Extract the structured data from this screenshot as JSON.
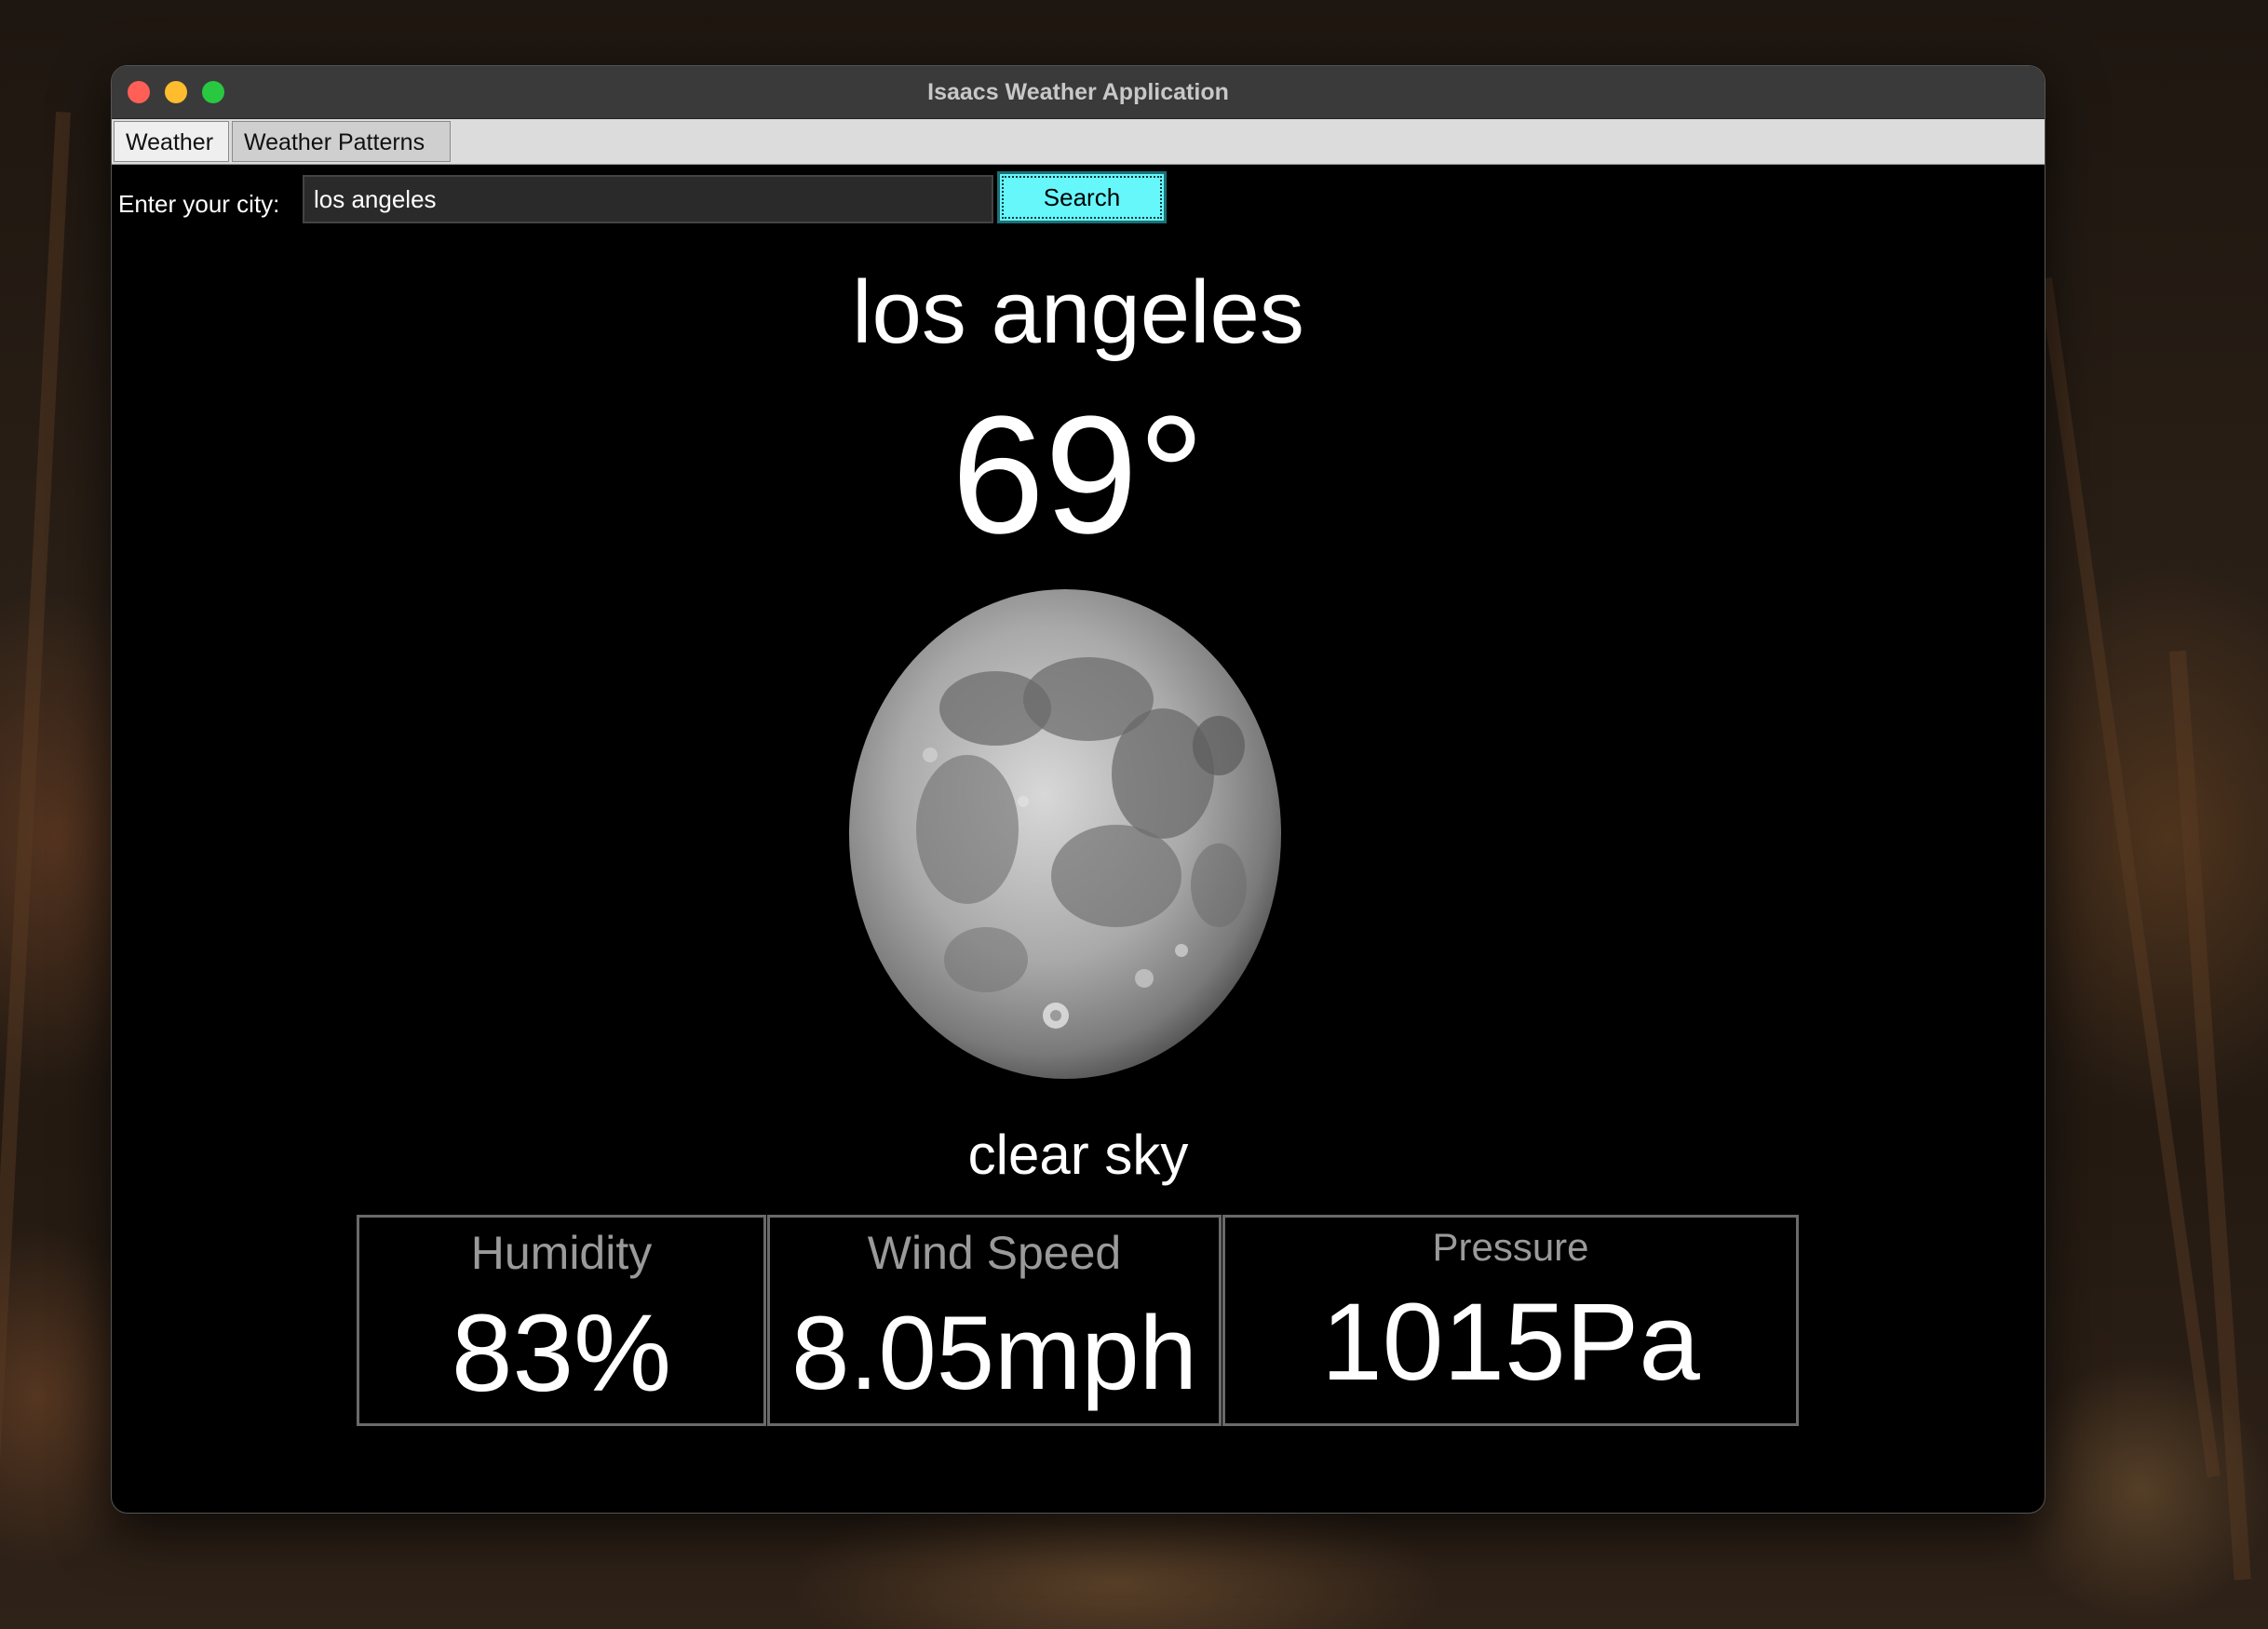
{
  "window": {
    "title": "Isaacs Weather Application"
  },
  "tabs": [
    {
      "label": "Weather",
      "selected": true
    },
    {
      "label": "Weather Patterns",
      "selected": false
    }
  ],
  "search": {
    "label": "Enter your city:",
    "value": "los angeles",
    "button_label": "Search"
  },
  "weather": {
    "city": "los angeles",
    "temperature": "69°",
    "icon": "full-moon-icon",
    "description": "clear sky"
  },
  "stats": {
    "humidity": {
      "label": "Humidity",
      "value": "83%"
    },
    "wind_speed": {
      "label": "Wind Speed",
      "value": "8.05mph"
    },
    "pressure": {
      "label": "Pressure",
      "value": "1015Pa"
    }
  },
  "colors": {
    "background": "#000000",
    "search_button": "#66f7fb",
    "stat_label": "#9a9a9a",
    "text": "#ffffff"
  }
}
